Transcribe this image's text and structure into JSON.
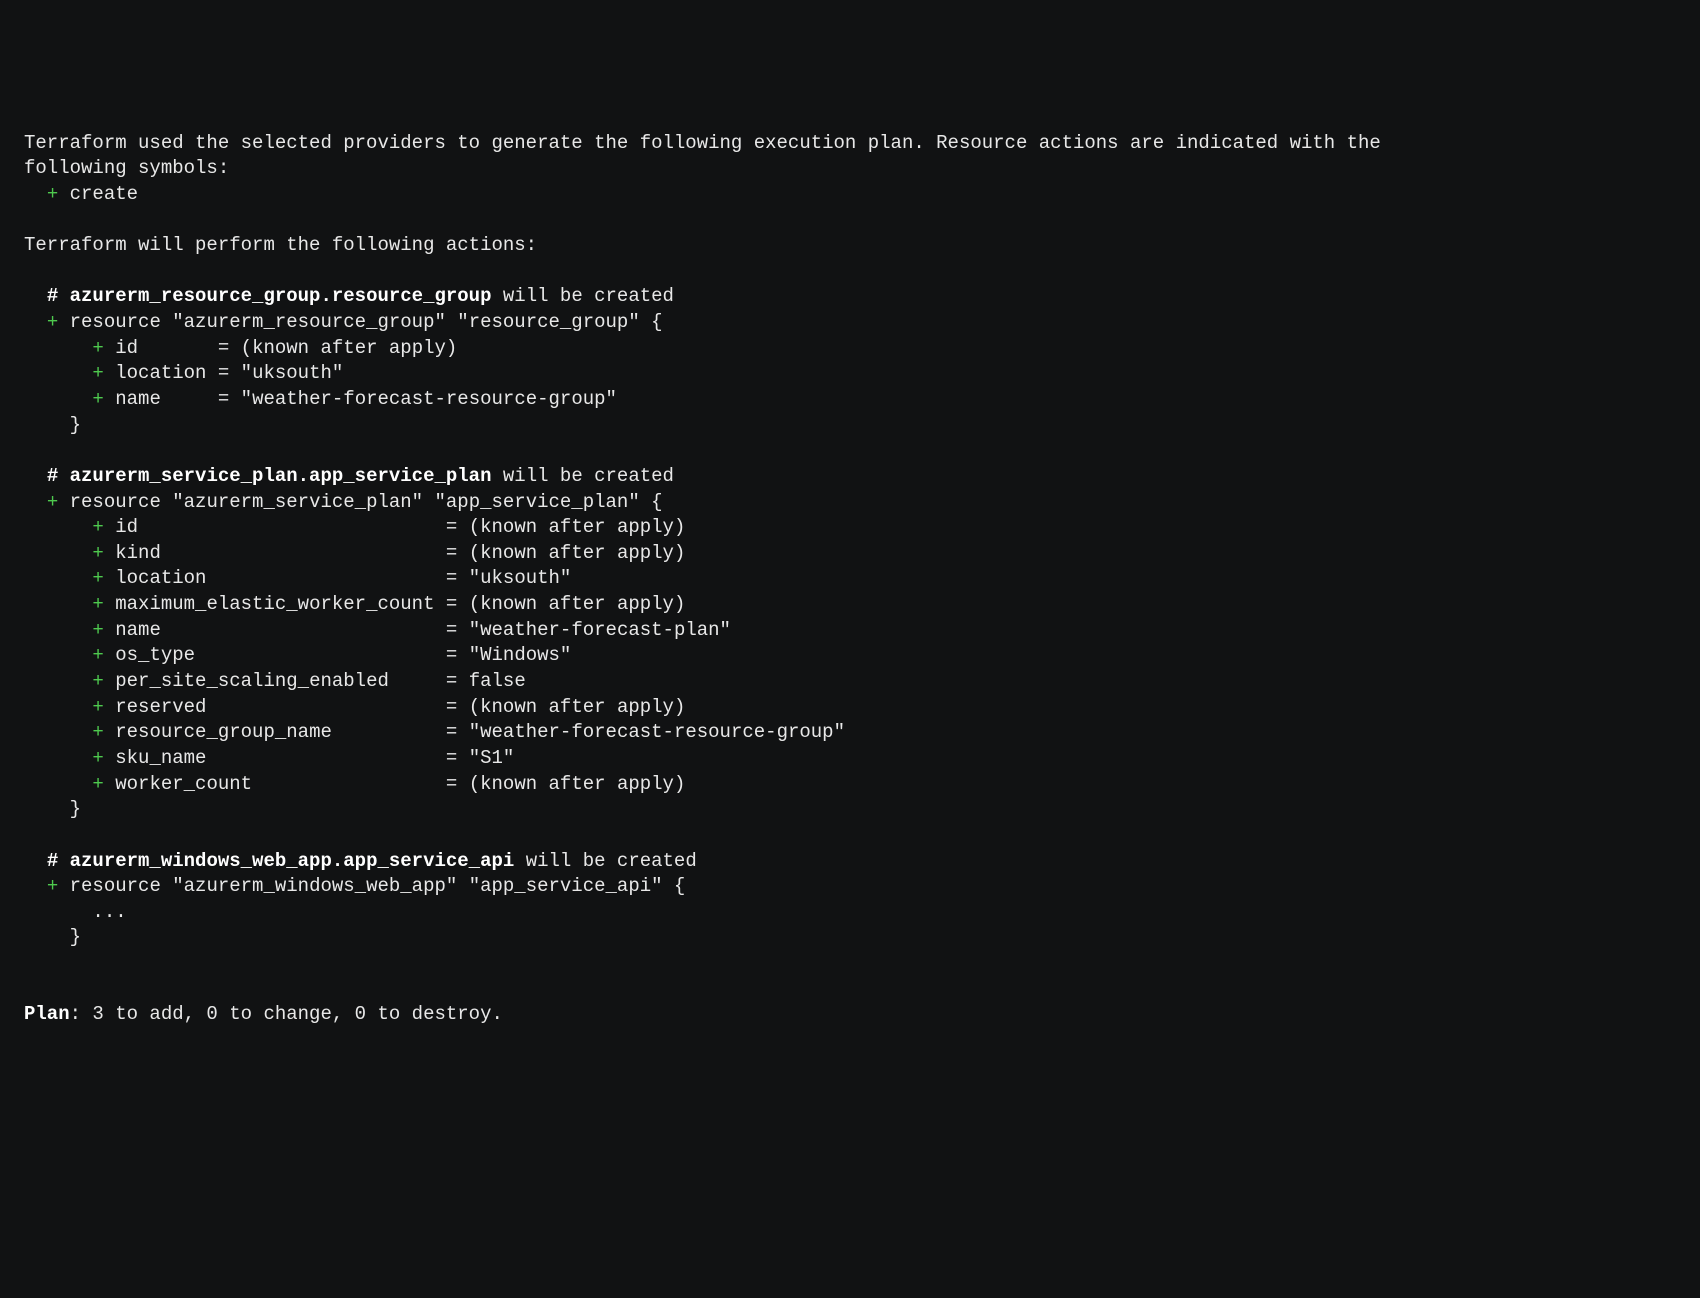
{
  "intro": {
    "line1": "Terraform used the selected providers to generate the following execution plan. Resource actions are indicated with the",
    "line2": "following symbols:",
    "create_symbol": "+",
    "create_label": "create"
  },
  "actions_header": "Terraform will perform the following actions:",
  "blocks": [
    {
      "comment_prefix": "#",
      "comment_resource": "azurerm_resource_group.resource_group",
      "comment_suffix": "will be created",
      "resource_decl": "resource \"azurerm_resource_group\" \"resource_group\" {",
      "attr_pad": 8,
      "attrs": [
        {
          "key": "id",
          "value": "(known after apply)"
        },
        {
          "key": "location",
          "value": "\"uksouth\""
        },
        {
          "key": "name",
          "value": "\"weather-forecast-resource-group\""
        }
      ],
      "ellipsis": false,
      "close": "}"
    },
    {
      "comment_prefix": "#",
      "comment_resource": "azurerm_service_plan.app_service_plan",
      "comment_suffix": "will be created",
      "resource_decl": "resource \"azurerm_service_plan\" \"app_service_plan\" {",
      "attr_pad": 28,
      "attrs": [
        {
          "key": "id",
          "value": "(known after apply)"
        },
        {
          "key": "kind",
          "value": "(known after apply)"
        },
        {
          "key": "location",
          "value": "\"uksouth\""
        },
        {
          "key": "maximum_elastic_worker_count",
          "value": "(known after apply)"
        },
        {
          "key": "name",
          "value": "\"weather-forecast-plan\""
        },
        {
          "key": "os_type",
          "value": "\"Windows\""
        },
        {
          "key": "per_site_scaling_enabled",
          "value": "false"
        },
        {
          "key": "reserved",
          "value": "(known after apply)"
        },
        {
          "key": "resource_group_name",
          "value": "\"weather-forecast-resource-group\""
        },
        {
          "key": "sku_name",
          "value": "\"S1\""
        },
        {
          "key": "worker_count",
          "value": "(known after apply)"
        }
      ],
      "ellipsis": false,
      "close": "}"
    },
    {
      "comment_prefix": "#",
      "comment_resource": "azurerm_windows_web_app.app_service_api",
      "comment_suffix": "will be created",
      "resource_decl": "resource \"azurerm_windows_web_app\" \"app_service_api\" {",
      "attr_pad": 0,
      "attrs": [],
      "ellipsis": true,
      "ellipsis_text": "...",
      "close": "}"
    }
  ],
  "plan_summary": {
    "prefix": "Plan",
    "text": ": 3 to add, 0 to change, 0 to destroy."
  }
}
